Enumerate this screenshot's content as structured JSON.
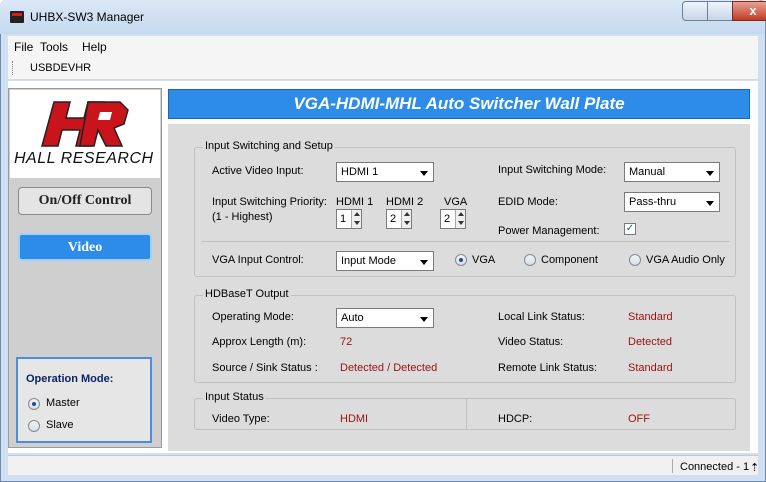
{
  "window": {
    "title": "UHBX-SW3 Manager",
    "close_glyph": "x"
  },
  "menu": [
    "File",
    "Tools",
    "Help"
  ],
  "toolbar": {
    "device": "USBDEVHR"
  },
  "logo": {
    "text": "HALL RESEARCH"
  },
  "sidebar": {
    "onoff_label": "On/Off Control",
    "video_label": "Video"
  },
  "operation_mode": {
    "title": "Operation Mode:",
    "options": [
      "Master",
      "Slave"
    ],
    "selected": "Master"
  },
  "banner": "VGA-HDMI-MHL Auto Switcher Wall Plate",
  "input_switching": {
    "group_title": "Input Switching and Setup",
    "active_video_input_label": "Active Video Input:",
    "active_video_input_value": "HDMI 1",
    "priority_label": "Input Switching Priority:",
    "priority_sub": "(1 - Highest)",
    "priority_cols": [
      "HDMI 1",
      "HDMI 2",
      "VGA"
    ],
    "priority_values": [
      "1",
      "2",
      "2"
    ],
    "switching_mode_label": "Input Switching Mode:",
    "switching_mode_value": "Manual",
    "edid_label": "EDID Mode:",
    "edid_value": "Pass-thru",
    "power_label": "Power Management:",
    "power_checked": true,
    "vga_control_label": "VGA Input Control:",
    "vga_control_value": "Input Mode",
    "vga_options": [
      "VGA",
      "Component",
      "VGA Audio Only"
    ],
    "vga_selected": "VGA"
  },
  "hdbaset": {
    "group_title": "HDBaseT Output",
    "operating_mode_label": "Operating Mode:",
    "operating_mode_value": "Auto",
    "approx_length_label": "Approx Length (m):",
    "approx_length_value": "72",
    "source_sink_label": "Source / Sink Status :",
    "source_sink_value": "Detected / Detected",
    "local_link_label": "Local Link Status:",
    "local_link_value": "Standard",
    "video_status_label": "Video Status:",
    "video_status_value": "Detected",
    "remote_link_label": "Remote Link Status:",
    "remote_link_value": "Standard"
  },
  "input_status": {
    "group_title": "Input Status",
    "video_type_label": "Video Type:",
    "video_type_value": "HDMI",
    "hdcp_label": "HDCP:",
    "hdcp_value": "OFF"
  },
  "status": {
    "connection": "Connected - 1"
  },
  "colors": {
    "accent": "#2d8ce8",
    "value_red": "#9b1111"
  }
}
